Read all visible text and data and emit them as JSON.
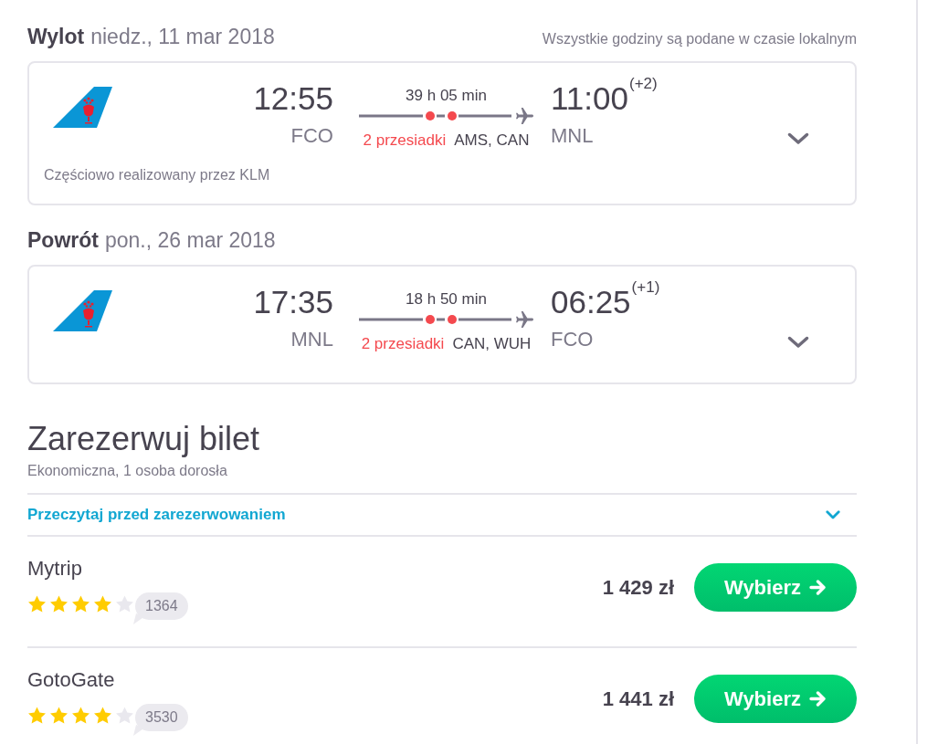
{
  "flights": [
    {
      "label": "Wylot",
      "date": "niedz., 11 mar 2018",
      "note": "Wszystkie godziny są podane w czasie lokalnym",
      "departure": {
        "time": "12:55",
        "airport": "FCO"
      },
      "duration": "39 h 05 min",
      "stops": "2 przesiadki",
      "via": "AMS, CAN",
      "arrival": {
        "time": "11:00",
        "day_offset": "(+2)",
        "airport": "MNL"
      },
      "operated_by": "Częściowo realizowany przez KLM",
      "expanded": false
    },
    {
      "label": "Powrót",
      "date": "pon., 26 mar 2018",
      "departure": {
        "time": "17:35",
        "airport": "MNL"
      },
      "duration": "18 h 50 min",
      "stops": "2 przesiadki",
      "via": "CAN, WUH",
      "arrival": {
        "time": "06:25",
        "day_offset": "(+1)",
        "airport": "FCO"
      },
      "expanded": false
    }
  ],
  "booking": {
    "title": "Zarezerwuj bilet",
    "subtitle": "Ekonomiczna, 1 osoba dorosła",
    "notice": {
      "label": "Przeczytaj przed zarezerwowaniem",
      "expanded": false
    },
    "offers": [
      {
        "provider": "Mytrip",
        "stars": 4,
        "reviews": "1364",
        "price": "1 429 zł",
        "button": "Wybierz"
      },
      {
        "provider": "GotoGate",
        "stars": 4,
        "reviews": "3530",
        "price": "1 441 zł",
        "button": "Wybierz"
      }
    ]
  }
}
